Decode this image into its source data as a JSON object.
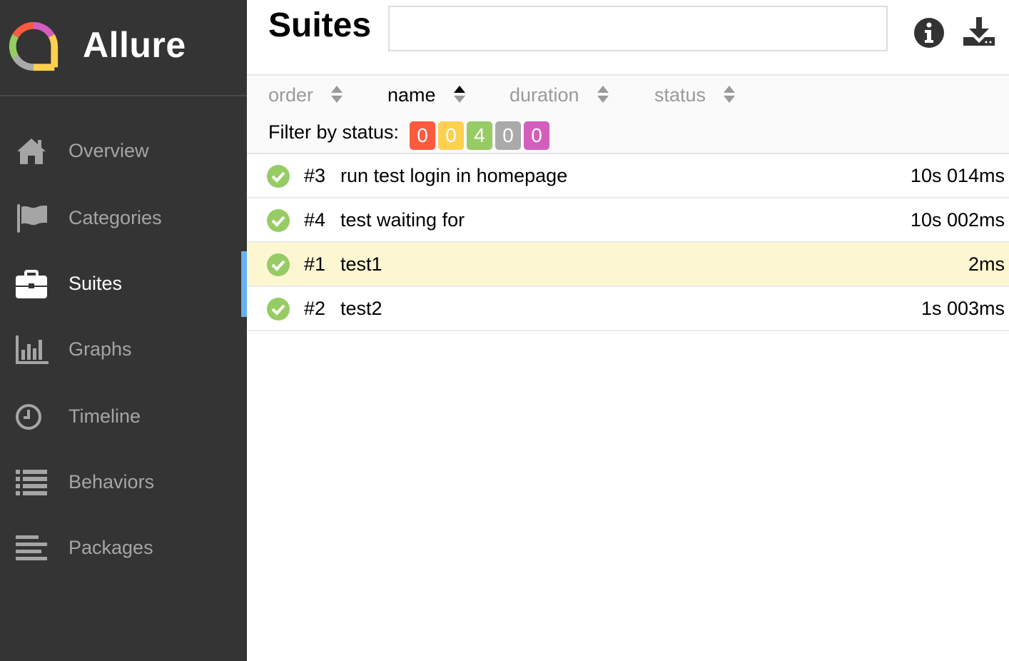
{
  "brand": {
    "name": "Allure"
  },
  "sidebar": {
    "items": [
      {
        "label": "Overview",
        "icon": "home-icon",
        "active": false
      },
      {
        "label": "Categories",
        "icon": "flag-icon",
        "active": false
      },
      {
        "label": "Suites",
        "icon": "briefcase-icon",
        "active": true
      },
      {
        "label": "Graphs",
        "icon": "bar-chart-icon",
        "active": false
      },
      {
        "label": "Timeline",
        "icon": "clock-icon",
        "active": false
      },
      {
        "label": "Behaviors",
        "icon": "list-icon",
        "active": false
      },
      {
        "label": "Packages",
        "icon": "align-left-icon",
        "active": false
      }
    ]
  },
  "header": {
    "title": "Suites",
    "search": {
      "value": "",
      "placeholder": ""
    },
    "info_icon": "info-icon",
    "download_icon": "download-icon"
  },
  "sorters": [
    {
      "label": "order",
      "active": false
    },
    {
      "label": "name",
      "active": true
    },
    {
      "label": "duration",
      "active": false
    },
    {
      "label": "status",
      "active": false
    }
  ],
  "filter": {
    "label": "Filter by status:",
    "badges": [
      {
        "status": "failed",
        "count": "0",
        "color": "#fd5a3e"
      },
      {
        "status": "broken",
        "count": "0",
        "color": "#ffd050"
      },
      {
        "status": "passed",
        "count": "4",
        "color": "#97cc64"
      },
      {
        "status": "skipped",
        "count": "0",
        "color": "#aaaaaa"
      },
      {
        "status": "unknown",
        "count": "0",
        "color": "#d35ebe"
      }
    ]
  },
  "tests": [
    {
      "num": "#3",
      "name": "run test login in homepage",
      "duration": "10s 014ms",
      "status": "passed",
      "selected": false
    },
    {
      "num": "#4",
      "name": "test waiting for",
      "duration": "10s 002ms",
      "status": "passed",
      "selected": false
    },
    {
      "num": "#1",
      "name": "test1",
      "duration": "2ms",
      "status": "passed",
      "selected": true
    },
    {
      "num": "#2",
      "name": "test2",
      "duration": "1s 003ms",
      "status": "passed",
      "selected": false
    }
  ],
  "colors": {
    "sidebar_bg": "#343434",
    "active_indicator": "#69b0ee",
    "passed": "#97cc64",
    "selected_row": "#fdf7d1"
  }
}
